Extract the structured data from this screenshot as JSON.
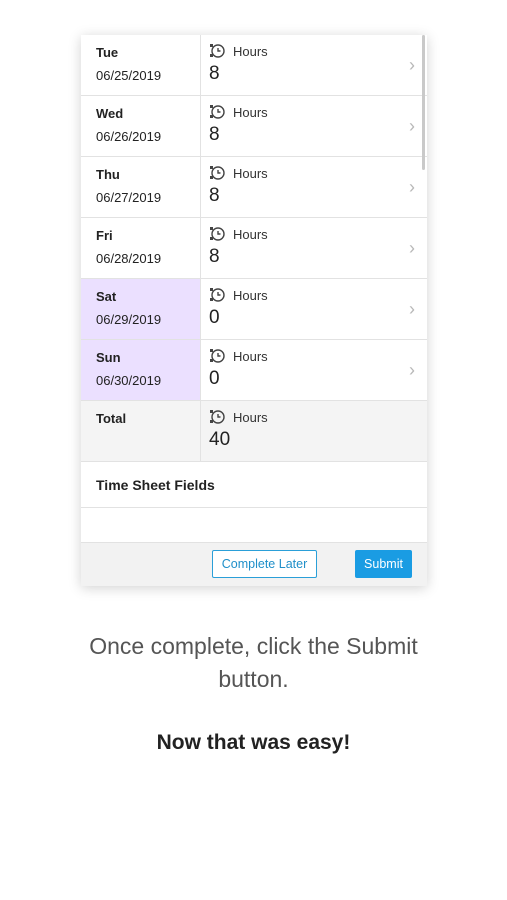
{
  "days": [
    {
      "day": "Tue",
      "date": "06/25/2019",
      "hours_label": "Hours",
      "hours": "8",
      "weekend": false
    },
    {
      "day": "Wed",
      "date": "06/26/2019",
      "hours_label": "Hours",
      "hours": "8",
      "weekend": false
    },
    {
      "day": "Thu",
      "date": "06/27/2019",
      "hours_label": "Hours",
      "hours": "8",
      "weekend": false
    },
    {
      "day": "Fri",
      "date": "06/28/2019",
      "hours_label": "Hours",
      "hours": "8",
      "weekend": false
    },
    {
      "day": "Sat",
      "date": "06/29/2019",
      "hours_label": "Hours",
      "hours": "0",
      "weekend": true
    },
    {
      "day": "Sun",
      "date": "06/30/2019",
      "hours_label": "Hours",
      "hours": "0",
      "weekend": true
    }
  ],
  "total": {
    "label": "Total",
    "hours_label": "Hours",
    "hours": "40"
  },
  "sections": {
    "time_sheet_fields": "Time Sheet Fields"
  },
  "buttons": {
    "complete_later": "Complete Later",
    "submit": "Submit"
  },
  "caption": {
    "line1": "Once complete, click the Submit",
    "line2": "button."
  },
  "tagline": "Now that was easy!",
  "colors": {
    "accent": "#1a9ce3",
    "weekend_bg": "#ebe0ff"
  },
  "icons": {
    "hours": "clock-history-icon",
    "row_action": "chevron-right-icon"
  }
}
